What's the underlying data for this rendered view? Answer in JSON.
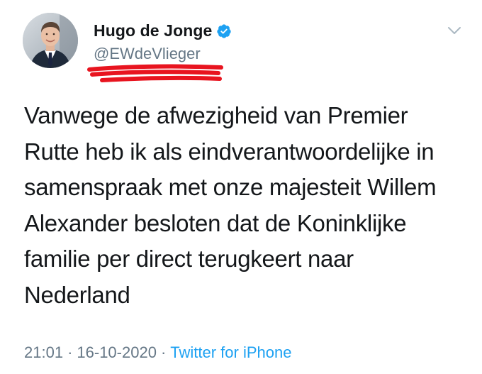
{
  "author": {
    "display_name": "Hugo de Jonge",
    "handle": "@EWdeVlieger",
    "verified": true
  },
  "tweet": {
    "text": "Vanwege de afwezigheid van Premier\nRutte heb ik als eindverantwoordelijke in\nsamenspraak met onze majesteit Willem\nAlexander besloten dat de Koninklijke\nfamilie per direct terugkeert naar\nNederland"
  },
  "meta": {
    "time": "21:01",
    "separator": "·",
    "date": "16-10-2020",
    "source": "Twitter for iPhone"
  },
  "icons": {
    "verified": "verified-badge-icon",
    "menu": "chevron-down-icon"
  },
  "colors": {
    "verified": "#1da1f2",
    "link": "#1da1f2",
    "secondary_text": "#657786",
    "primary_text": "#14171a",
    "redaction_scribble": "#e8141f"
  }
}
